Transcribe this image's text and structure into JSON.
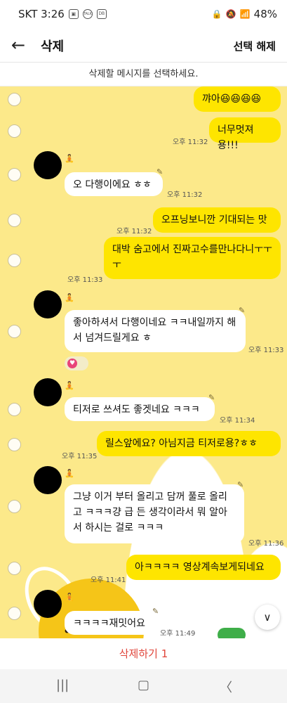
{
  "status_bar": {
    "carrier_time": "SKT 3:26",
    "battery": "48%",
    "app_badges": [
      "TALK",
      "DB"
    ]
  },
  "header": {
    "title": "삭제",
    "deselect_label": "선택 해제"
  },
  "instruction": "삭제할 메시지를 선택하세요.",
  "messages": [
    {
      "text": "꺄아😆😆😆😆",
      "time": ""
    },
    {
      "text": "너무멋져용!!!",
      "time": "오후 11:32"
    },
    {
      "text": "오 다행이에요 ㅎㅎ",
      "time": "오후 11:32"
    },
    {
      "text": "오프닝보니깐 기대되는 맛",
      "time": "오후 11:32"
    },
    {
      "text": "대박 숨고에서 진짜고수를만나다니ㅜㅜㅜ",
      "time": "오후 11:33"
    },
    {
      "text": "좋아하셔서 다행이네요 ㅋㅋ내일까지 해서 넘겨드릴게요 ㅎ",
      "time": "오후 11:33"
    },
    {
      "text": "티저로 쓰셔도 좋겟네요 ㅋㅋㅋ",
      "time": "오후 11:34"
    },
    {
      "text": "릴스앞에요?  아님지금 티저로용?ㅎㅎ",
      "time": "오후 11:35"
    },
    {
      "text": "그냥 이거 부터 올리고 담꺼 풀로 올리고 ㅋㅋㅋ걍 급 든 생각이라서 뭐 알아서 하시는 걸로 ㅋㅋㅋ",
      "time": "오후 11:36"
    },
    {
      "text": "아ㅋㅋㅋㅋ 영상계속보게되네요",
      "time": "오후 11:41"
    },
    {
      "text": "ㅋㅋㅋㅋ재밋어요",
      "time": "오후 11:49"
    }
  ],
  "delete_button": "삭제하기 1",
  "colors": {
    "chat_bg": "#fce98a",
    "outgoing_bubble": "#fee500",
    "incoming_bubble": "#ffffff",
    "delete_text": "#e0453a"
  }
}
